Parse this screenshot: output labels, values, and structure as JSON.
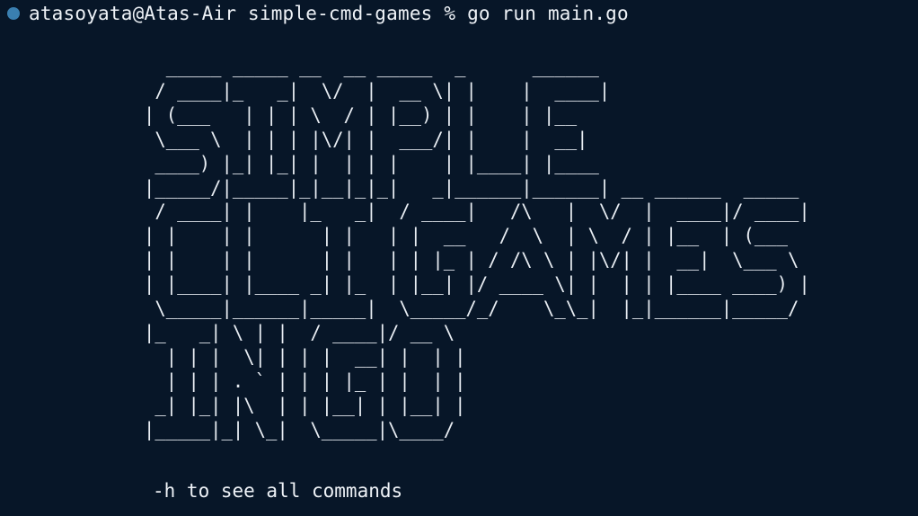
{
  "terminal": {
    "prompt": {
      "user_host": "atasoyata@Atas-Air",
      "directory": "simple-cmd-games",
      "symbol": "%",
      "command": "go run main.go",
      "status_dot_color": "#3a7fb0"
    },
    "banner_lines": [
      "  _____ _____ __  __ _____  _      ______",
      " / ____|_   _|  \\/  |  __ \\| |    |  ____|",
      "| (___   | | | \\  / | |__) | |    | |__",
      " \\___ \\  | | | |\\/| |  ___/| |    |  __|",
      " ____) |_| |_| |  | | |    | |____| |____",
      "|_____/|_____|_|__|_|_|   _|______|______| __ ______  _____",
      " / ____| |    |_   _|  / ____|   /\\   |  \\/  |  ____|/ ____|",
      "| |    | |      | |   | |  __   /  \\  | \\  / | |__  | (___",
      "| |    | |      | |   | | |_ | / /\\ \\ | |\\/| |  __|  \\___ \\",
      "| |____| |____ _| |_  | |__| |/ ____ \\| |  | | |____ ____) |",
      " \\_____|______|_____|  \\_____/_/    \\_\\_|  |_|______|_____/",
      "|_   _| \\ | |  / ____|/ __ \\",
      "  | | |  \\| | | |  __| |  | |",
      "  | | | . ` | | | |_ | |  | |",
      " _| |_| |\\  | | |__| | |__| |",
      "|_____|_| \\_|  \\_____|\\____/"
    ],
    "hint": "-h to see all commands"
  }
}
